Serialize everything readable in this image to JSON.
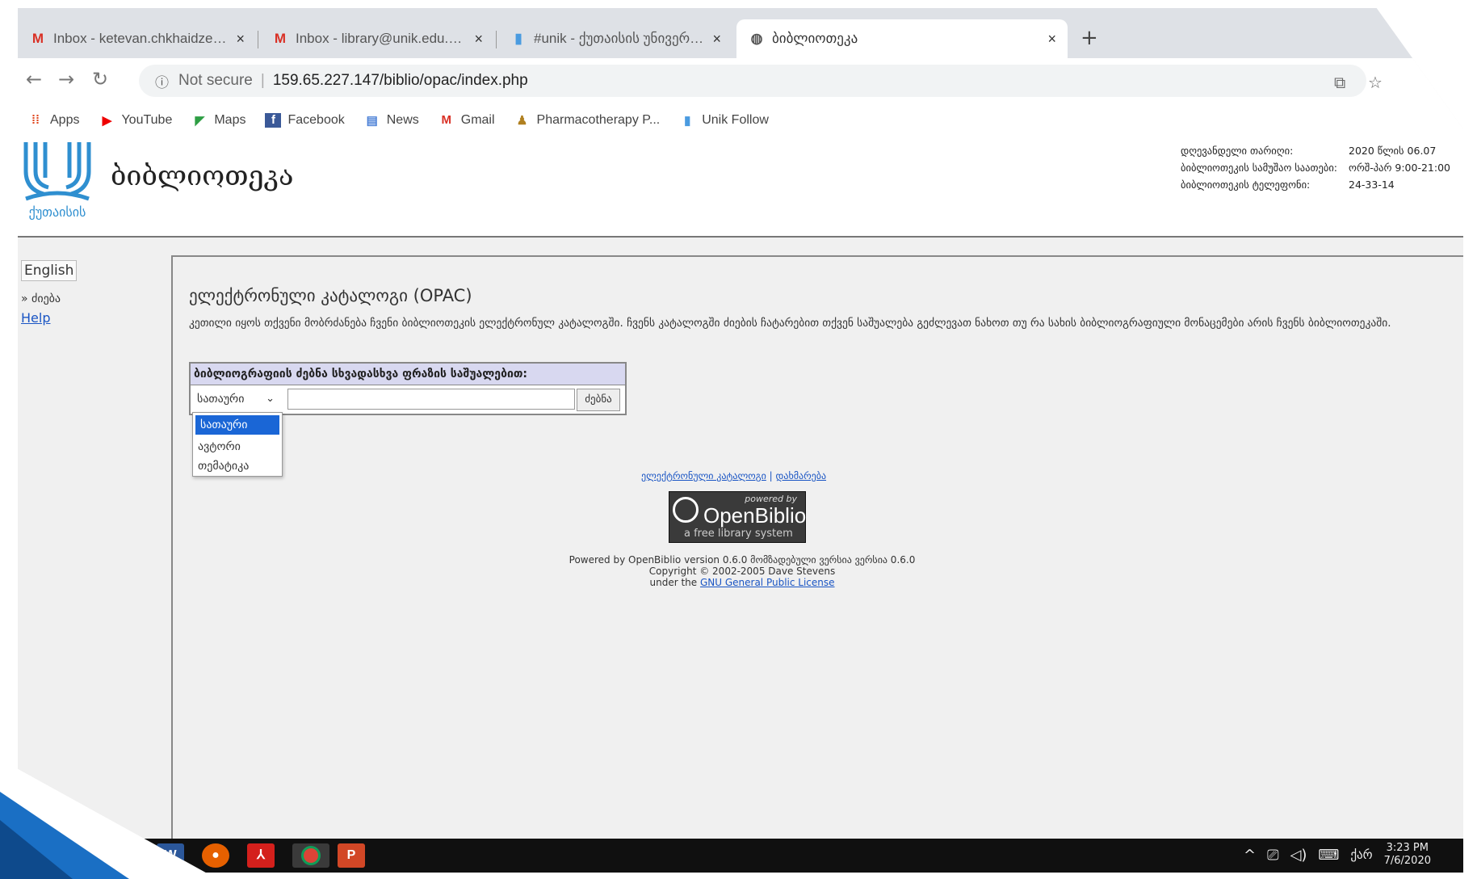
{
  "browser": {
    "tabs": [
      {
        "icon": "gmail-icon",
        "title": "Inbox - ketevan.chkhaidze@unik",
        "active": false
      },
      {
        "icon": "gmail-icon",
        "title": "Inbox - library@unik.edu.ge - K",
        "active": false
      },
      {
        "icon": "bookmark-icon",
        "title": "#unik - ქუთაისის უნივერსიტ",
        "active": false
      },
      {
        "icon": "globe-icon",
        "title": "ბიბლიოთეკა",
        "active": true
      }
    ],
    "new_tab": "+",
    "close_glyph": "×",
    "not_secure": "Not secure",
    "url": "159.65.227.147/biblio/opac/index.php",
    "bookmarks": [
      {
        "icon": "apps-icon",
        "label": "Apps"
      },
      {
        "icon": "youtube-icon",
        "label": "YouTube"
      },
      {
        "icon": "maps-icon",
        "label": "Maps"
      },
      {
        "icon": "facebook-icon",
        "label": "Facebook"
      },
      {
        "icon": "news-icon",
        "label": "News"
      },
      {
        "icon": "gmail-icon",
        "label": "Gmail"
      },
      {
        "icon": "pharmacotherapy-icon",
        "label": "Pharmacotherapy P..."
      },
      {
        "icon": "bookmark-icon",
        "label": "Unik Follow"
      }
    ]
  },
  "site": {
    "logo_text": "ქუთაისის",
    "title": "ბიბლიოთეკა",
    "info": [
      {
        "label": "დღევანდელი თარიღი:",
        "value": "2020 წლის 06.07"
      },
      {
        "label": "ბიბლიოთეკის სამუშაო საათები:",
        "value": "ორშ-პარ 9:00-21:00"
      },
      {
        "label": "ბიბლიოთეკის ტელეფონი:",
        "value": "24-33-14"
      }
    ]
  },
  "nav": {
    "language_button": "English",
    "search_link": "» ძიება",
    "help_link": "Help"
  },
  "main": {
    "title": "ელექტრონული კატალოგი (OPAC)",
    "description": "კეთილი იყოს თქვენი მობრძანება ჩვენი ბიბლიოთეკის ელექტრონულ კატალოგში. ჩვენს კატალოგში ძიების ჩატარებით თქვენ საშუალება გეძლევათ ნახოთ თუ რა სახის ბიბლიოგრაფიული მონაცემები არის ჩვენს ბიბლიოთეკაში.",
    "search": {
      "heading": "ბიბლიოგრაფიის ძებნა სხვადასხვა ფრაზის საშუალებით:",
      "selected": "სათაური",
      "value": "",
      "button": "ძებნა",
      "options": [
        "სათაური",
        "ავტორი",
        "თემატიკა"
      ]
    },
    "footer_links": {
      "catalog": "ელექტრონული კატალოგი",
      "separator": "|",
      "help": "დახმარება"
    },
    "openbiblio_logo": {
      "powered": "powered by",
      "name": "OpenBiblio",
      "tagline": "a free library system"
    },
    "powered_lines": [
      "Powered by OpenBiblio version 0.6.0 მომზადებული ვერსია ვერსია 0.6.0",
      "Copyright © 2002-2005 Dave Stevens",
      "under the"
    ],
    "license_link": "GNU General Public License"
  },
  "taskbar": {
    "apps": [
      "file-explorer-icon",
      "word-icon",
      "firefox-icon",
      "acrobat-icon",
      "chrome-icon",
      "powerpoint-icon"
    ],
    "lang": "ქარ",
    "time": "3:23 PM",
    "date": "7/6/2020"
  }
}
